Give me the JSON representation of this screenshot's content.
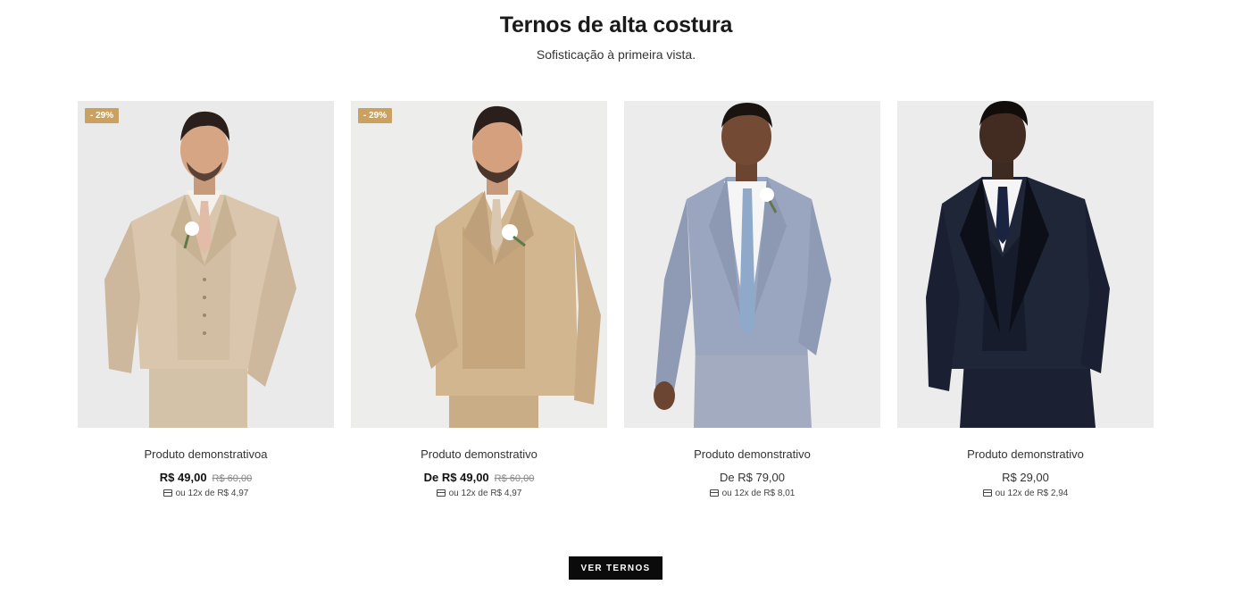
{
  "section": {
    "title": "Ternos de alta costura",
    "subtitle": "Sofisticação à primeira vista."
  },
  "products": [
    {
      "badge": "- 29%",
      "name": "Produto demonstrativoa",
      "price": "R$ 49,00",
      "old_price": "R$ 60,00",
      "installments": "ou 12x de R$ 4,97",
      "suit_color": "#d9c6ad",
      "tie_color": "#e2bca6"
    },
    {
      "badge": "- 29%",
      "name": "Produto demonstrativo",
      "price": "De R$ 49,00",
      "old_price": "R$ 60,00",
      "installments": "ou 12x de R$ 4,97",
      "suit_color": "#d1b690",
      "tie_color": "#d9c7b0"
    },
    {
      "name": "Produto demonstrativo",
      "price": "De R$ 79,00",
      "installments": "ou 12x de R$ 8,01",
      "suit_color": "#9aa5c0",
      "tie_color": "#8ea9c9"
    },
    {
      "name": "Produto demonstrativo",
      "price": "R$ 29,00",
      "installments": "ou 12x de R$ 2,94",
      "suit_color": "#1f2638",
      "tie_color": "#1a2340"
    }
  ],
  "cta": {
    "label": "VER TERNOS"
  }
}
